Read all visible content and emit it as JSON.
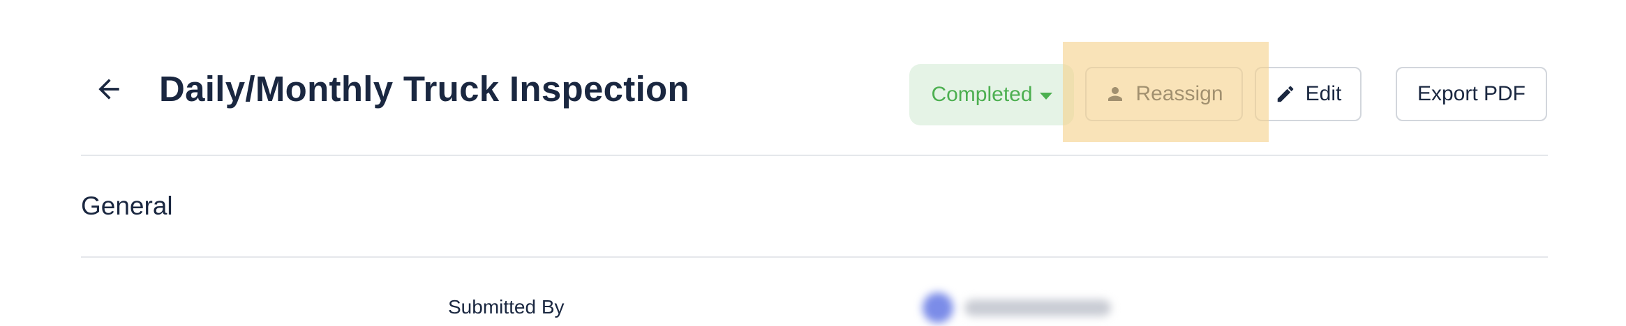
{
  "header": {
    "title": "Daily/Monthly Truck Inspection",
    "back_icon": "arrow-left-icon"
  },
  "actions": {
    "status_label": "Completed",
    "reassign_label": "Reassign",
    "reassign_icon": "person-icon",
    "edit_label": "Edit",
    "edit_icon": "pencil-icon",
    "export_label": "Export PDF"
  },
  "colors": {
    "status_text": "#4caf50",
    "status_bg": "#e5f3e6",
    "highlight": "#f6d28c",
    "title_text": "#1a2740"
  },
  "section": {
    "title": "General"
  },
  "fields": {
    "submitted_by_label": "Submitted By"
  }
}
